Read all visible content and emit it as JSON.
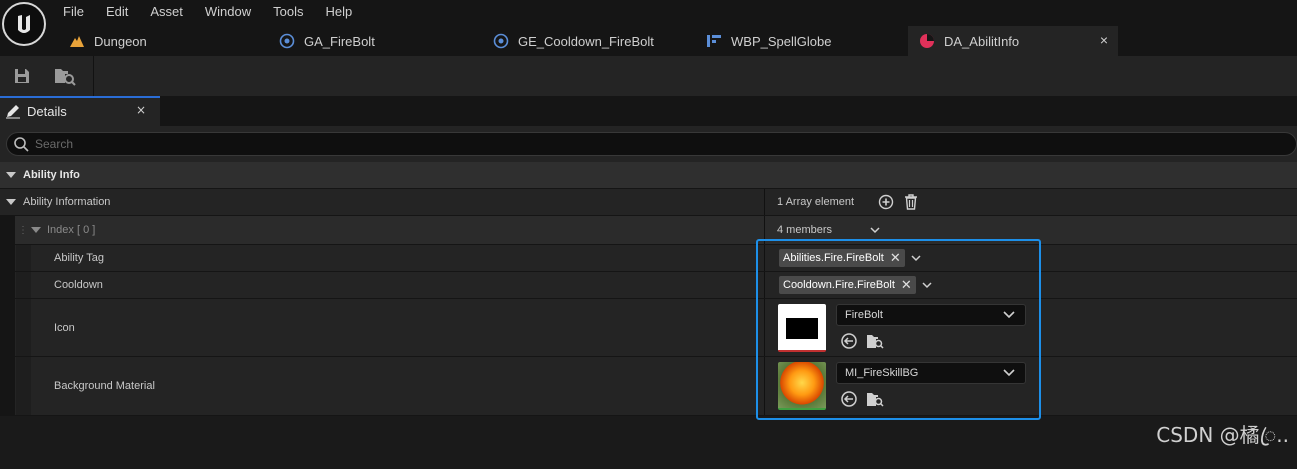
{
  "menu": [
    "File",
    "Edit",
    "Asset",
    "Window",
    "Tools",
    "Help"
  ],
  "tabs": [
    {
      "label": "Dungeon",
      "icon": "level-icon"
    },
    {
      "label": "GA_FireBolt",
      "icon": "blueprint-icon"
    },
    {
      "label": "GE_Cooldown_FireBolt",
      "icon": "blueprint-icon"
    },
    {
      "label": "WBP_SpellGlobe",
      "icon": "widget-blueprint-icon"
    },
    {
      "label": "DA_AbilitInfo",
      "icon": "data-asset-icon",
      "active": true,
      "close": "×"
    }
  ],
  "details": {
    "tab_label": "Details",
    "tab_close": "×",
    "search_placeholder": "Search"
  },
  "categories": {
    "ability_info": "Ability Info"
  },
  "rows": {
    "ability_information": {
      "name": "Ability Information",
      "value": "1 Array element"
    },
    "index": {
      "name": "Index [ 0 ]",
      "value": "4 members"
    },
    "ability_tag": {
      "name": "Ability Tag",
      "value": "Abilities.Fire.FireBolt"
    },
    "cooldown": {
      "name": "Cooldown",
      "value": "Cooldown.Fire.FireBolt"
    },
    "icon": {
      "name": "Icon",
      "value": "FireBolt"
    },
    "background_material": {
      "name": "Background Material",
      "value": "MI_FireSkillBG"
    }
  },
  "colors": {
    "highlight_border": "#1d8fe8",
    "active_tab_accent": "#2a6dd6",
    "data_asset_icon": "#e0315a"
  },
  "watermark": "CSDN @橘ꦿ.."
}
